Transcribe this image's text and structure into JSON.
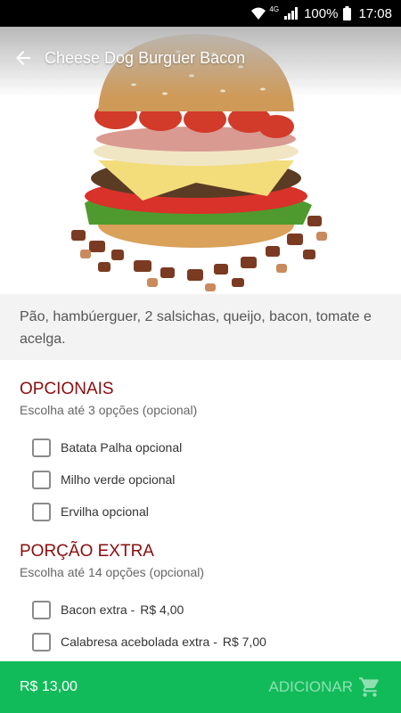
{
  "status_bar": {
    "network": "4G",
    "battery": "100%",
    "time": "17:08"
  },
  "header": {
    "title": "Cheese Dog Burguer Bacon",
    "back_icon": "arrow-left-icon"
  },
  "product": {
    "image": "burger-photo",
    "description": "Pão, hambúerguer, 2 salsichas, queijo, bacon, tomate e acelga."
  },
  "groups": [
    {
      "title": "OPCIONAIS",
      "subtitle": "Escolha até 3 opções (opcional)",
      "options": [
        {
          "label": "Batata Palha opcional",
          "price": ""
        },
        {
          "label": "Milho verde opcional",
          "price": ""
        },
        {
          "label": "Ervilha opcional",
          "price": ""
        }
      ]
    },
    {
      "title": "PORÇÃO EXTRA",
      "subtitle": "Escolha até 14 opções (opcional)",
      "options": [
        {
          "label": "Bacon extra -",
          "price": "R$ 4,00"
        },
        {
          "label": "Calabresa acebolada extra -",
          "price": "R$ 7,00"
        }
      ]
    }
  ],
  "footer": {
    "total": "R$ 13,00",
    "add_label": "ADICIONAR",
    "cart_icon": "cart-icon"
  },
  "colors": {
    "accent_green": "#11bb5a",
    "section_title_red": "#8b0d0d"
  }
}
